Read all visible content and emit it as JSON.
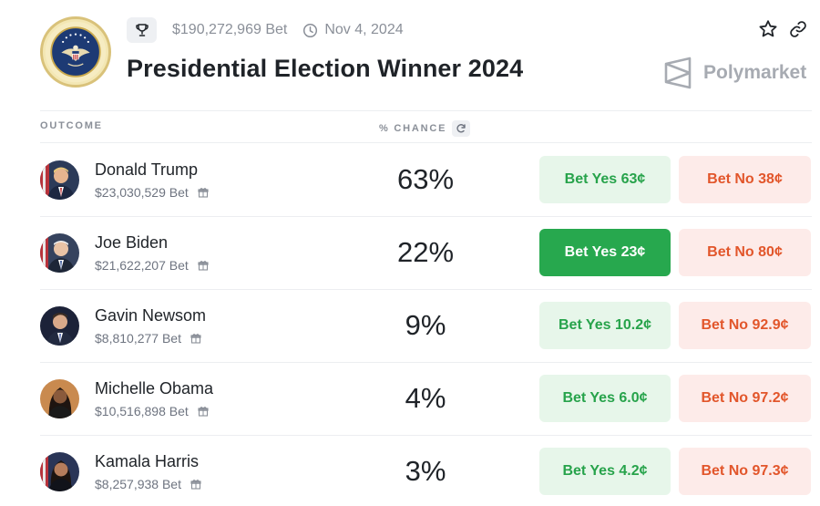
{
  "header": {
    "volume": "$190,272,969 Bet",
    "date": "Nov 4, 2024",
    "title": "Presidential Election Winner 2024",
    "brand": "Polymarket"
  },
  "columns": {
    "outcome": "OUTCOME",
    "chance": "% CHANCE"
  },
  "outcomes": [
    {
      "name": "Donald Trump",
      "volume": "$23,030,529 Bet",
      "chance": "63%",
      "yes": "Bet Yes 63¢",
      "no": "Bet No 38¢"
    },
    {
      "name": "Joe Biden",
      "volume": "$21,622,207 Bet",
      "chance": "22%",
      "yes": "Bet Yes 23¢",
      "no": "Bet No 80¢"
    },
    {
      "name": "Gavin Newsom",
      "volume": "$8,810,277 Bet",
      "chance": "9%",
      "yes": "Bet Yes 10.2¢",
      "no": "Bet No 92.9¢"
    },
    {
      "name": "Michelle Obama",
      "volume": "$10,516,898 Bet",
      "chance": "4%",
      "yes": "Bet Yes 6.0¢",
      "no": "Bet No 97.2¢"
    },
    {
      "name": "Kamala Harris",
      "volume": "$8,257,938 Bet",
      "chance": "3%",
      "yes": "Bet Yes 4.2¢",
      "no": "Bet No 97.3¢"
    }
  ],
  "icons": {
    "seal": "presidential-seal-icon",
    "trophy": "trophy-icon",
    "clock": "clock-icon",
    "star": "star-icon",
    "link": "link-icon",
    "brand": "polymarket-logo-icon",
    "refresh": "refresh-icon",
    "gift": "gift-icon"
  },
  "colors": {
    "yes_bg": "#e7f6ea",
    "yes_text": "#27a34b",
    "yes_active_bg": "#27a84e",
    "no_bg": "#fdebe9",
    "no_text": "#e2562b"
  }
}
